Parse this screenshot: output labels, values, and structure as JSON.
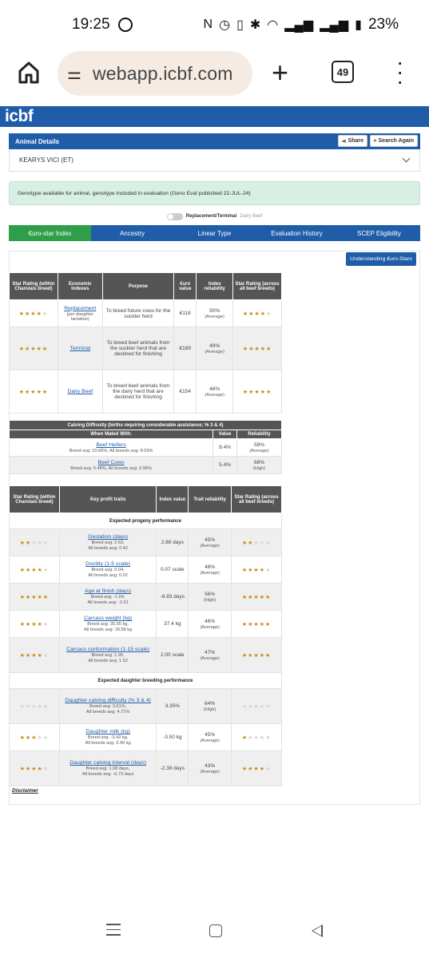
{
  "status": {
    "time": "19:25",
    "battery": "23%"
  },
  "browser": {
    "url": "webapp.icbf.com",
    "tab_count": "49"
  },
  "site": {
    "logo": "icbf"
  },
  "header": {
    "title": "Animal Details",
    "share": "Share",
    "search_again": "« Search Again"
  },
  "animal": {
    "name": "KEARYS VICI (ET)"
  },
  "genotype_notice": "Genotype available for animal, genotype included in evaluation (Geno Eval published 22-JUL-24)",
  "toggle": {
    "label": "Replacement/Terminal",
    "alt": "Dairy Beef"
  },
  "tabs": [
    "€uro-star Index",
    "Ancestry",
    "Linear Type",
    "Evaluation History",
    "SCEP Eligibility"
  ],
  "understanding_button": "Understanding €uro-Stars",
  "index_table": {
    "headers": [
      "Star Rating (within Charolais breed)",
      "Economic Indexes",
      "Purpose",
      "€uro value",
      "Index reliability",
      "Star Rating (across all beef breeds)"
    ],
    "rows": [
      {
        "stars_within": 4,
        "index": "Replacement",
        "index_note": "(per daughter lactation)",
        "purpose": "To breed future cows for the suckler herd",
        "value": "€118",
        "reliability": "50%",
        "reliability_label": "(Average)",
        "stars_across": 4
      },
      {
        "stars_within": 5,
        "index": "Terminal",
        "index_note": "",
        "purpose": "To breed beef animals from the suckler herd that are destined for finishing",
        "value": "€169",
        "reliability": "49%",
        "reliability_label": "(Average)",
        "stars_across": 5
      },
      {
        "stars_within": 5,
        "index": "Dairy Beef",
        "index_note": "",
        "purpose": "To breed beef animals from the dairy herd that are destined for finishing",
        "value": "€154",
        "reliability": "46%",
        "reliability_label": "(Average)",
        "stars_across": 5
      }
    ]
  },
  "calving_table": {
    "title": "Calving Difficulty (births requiring considerable assistance; % 3 & 4)",
    "headers": [
      "When Mated With:",
      "Value",
      "Reliability"
    ],
    "rows": [
      {
        "label": "Beef Heifers",
        "note": "Breed avg: 10.66%, All breeds avg: 8.03%",
        "value": "9.4%",
        "reliability": "58%",
        "reliability_label": "(Average)"
      },
      {
        "label": "Beef Cows",
        "note": "Breed avg: 5.48%, All breeds avg: 3.95%",
        "value": "5.4%",
        "reliability": "68%",
        "reliability_label": "(High)"
      }
    ]
  },
  "traits_table": {
    "headers": [
      "Star Rating (within Charolais breed)",
      "Key profit traits",
      "Index value",
      "Trait reliability",
      "Star Rating (across all beef breeds)"
    ],
    "section_progeny": "Expected progeny performance",
    "section_daughter": "Expected daughter breeding performance",
    "progeny": [
      {
        "stars_within": 2,
        "trait": "Gestation (days)",
        "breed_avg": "Breed avg: 2.63,",
        "all_avg": "All breeds avg: 2.42",
        "value": "2.88 days",
        "reliability": "45%",
        "reliability_label": "(Average)",
        "stars_across": 2
      },
      {
        "stars_within": 4,
        "trait": "Docility (1-5 scale)",
        "breed_avg": "Breed avg: 0.04,",
        "all_avg": "All breeds avg: 0.02",
        "value": "0.07 scale",
        "reliability": "48%",
        "reliability_label": "(Average)",
        "stars_across": 4
      },
      {
        "stars_within": 5,
        "trait": "Age at finish (days)",
        "breed_avg": "Breed avg: -1.64,",
        "all_avg": "All breeds avg: -1.51",
        "value": "-8.83 days",
        "reliability": "56%",
        "reliability_label": "(High)",
        "stars_across": 5
      },
      {
        "stars_within": 4,
        "trait": "Carcass weight (kg)",
        "breed_avg": "Breed avg: 35.55 kg,",
        "all_avg": "All breeds avg: 18.58 kg",
        "value": "37.4 kg",
        "reliability": "46%",
        "reliability_label": "(Average)",
        "stars_across": 5
      },
      {
        "stars_within": 4,
        "trait": "Carcass conformation (1-15 scale)",
        "breed_avg": "Breed avg: 1.95,",
        "all_avg": "All breeds avg: 1.52",
        "value": "2.00 scale",
        "reliability": "47%",
        "reliability_label": "(Average)",
        "stars_across": 5
      }
    ],
    "daughter": [
      {
        "stars_within": 0,
        "trait": "Daughter calving difficulty (% 3 & 4)",
        "breed_avg": "Breed avg: 3.61%,",
        "all_avg": "All breeds avg: 4.71%",
        "value": "3.35%",
        "reliability": "64%",
        "reliability_label": "(High)",
        "stars_across": 0
      },
      {
        "stars_within": 3,
        "trait": "Daughter milk (kg)",
        "breed_avg": "Breed avg: -3.43 kg,",
        "all_avg": "All breeds avg: 2.49 kg",
        "value": "-3.50 kg",
        "reliability": "45%",
        "reliability_label": "(Average)",
        "stars_across": 1
      },
      {
        "stars_within": 4,
        "trait": "Daughter calving interval (days)",
        "breed_avg": "Breed avg: 1.08 days,",
        "all_avg": "All breeds avg: -0.73 days",
        "value": "-2.38 days",
        "reliability": "43%",
        "reliability_label": "(Average)",
        "stars_across": 4
      }
    ]
  },
  "disclaimer": "Disclaimer"
}
